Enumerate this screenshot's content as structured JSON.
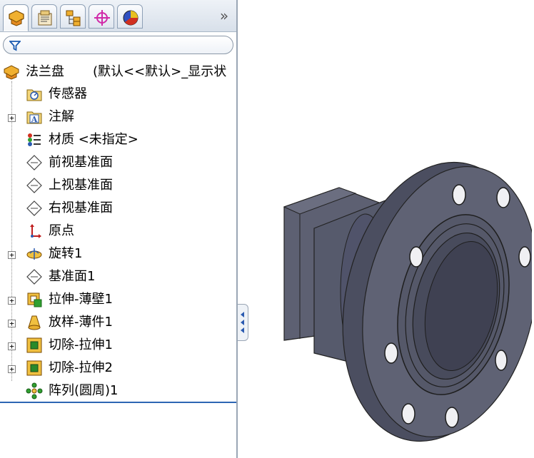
{
  "tabs": [
    {
      "name": "feature-manager",
      "active": true
    },
    {
      "name": "property-manager",
      "active": false
    },
    {
      "name": "configuration-manager",
      "active": false
    },
    {
      "name": "dimxpert-manager",
      "active": false
    },
    {
      "name": "display-manager",
      "active": false
    }
  ],
  "tabs_more": "»",
  "tree": {
    "root": {
      "label": "法兰盘",
      "config": "(默认<<默认>_显示状"
    },
    "items": [
      {
        "label": "传感器",
        "icon": "sensor-folder-icon",
        "expandable": false
      },
      {
        "label": "注解",
        "icon": "annotation-icon",
        "expandable": true
      },
      {
        "label": "材质 <未指定>",
        "icon": "material-icon",
        "expandable": false
      },
      {
        "label": "前视基准面",
        "icon": "plane-icon",
        "expandable": false
      },
      {
        "label": "上视基准面",
        "icon": "plane-icon",
        "expandable": false
      },
      {
        "label": "右视基准面",
        "icon": "plane-icon",
        "expandable": false
      },
      {
        "label": "原点",
        "icon": "origin-icon",
        "expandable": false
      },
      {
        "label": "旋转1",
        "icon": "revolve-icon",
        "expandable": true
      },
      {
        "label": "基准面1",
        "icon": "plane-icon",
        "expandable": false
      },
      {
        "label": "拉伸-薄壁1",
        "icon": "extrude-thin-icon",
        "expandable": true
      },
      {
        "label": "放样-薄件1",
        "icon": "loft-thin-icon",
        "expandable": true
      },
      {
        "label": "切除-拉伸1",
        "icon": "cut-extrude-icon",
        "expandable": true
      },
      {
        "label": "切除-拉伸2",
        "icon": "cut-extrude-icon",
        "expandable": true
      },
      {
        "label": "阵列(圆周)1",
        "icon": "circular-pattern-icon",
        "expandable": false
      }
    ]
  },
  "colors": {
    "model_body": "#5b5e70",
    "model_dark": "#3c3e4c",
    "selection_line": "#2d66b3"
  }
}
